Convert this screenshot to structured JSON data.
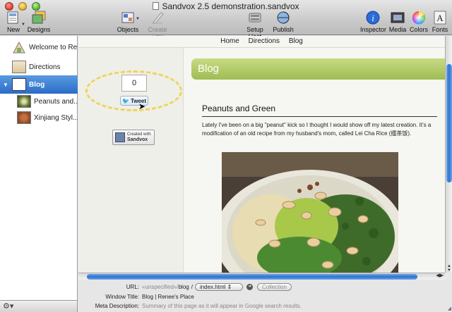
{
  "window": {
    "title": "Sandvox 2.5 demonstration.sandvox"
  },
  "toolbar": {
    "new_label": "New",
    "designs_label": "Designs",
    "objects_label": "Objects",
    "create_link_label": "Create Link",
    "setup_host_label": "Setup Host",
    "publish_label": "Publish",
    "inspector_label": "Inspector",
    "media_label": "Media",
    "colors_label": "Colors",
    "fonts_label": "Fonts"
  },
  "sidebar": {
    "items": [
      {
        "label": "Welcome to Re..."
      },
      {
        "label": "Directions"
      },
      {
        "label": "Blog",
        "expanded": true,
        "selected": true
      },
      {
        "label": "Peanuts and..."
      },
      {
        "label": "Xinjiang Styl..."
      }
    ]
  },
  "site": {
    "nav": [
      "Home",
      "Directions",
      "Blog"
    ],
    "tweet_count": "0",
    "tweet_label": "Tweet",
    "badge_line1": "Created with",
    "badge_line2": "Sandvox",
    "section_title": "Blog",
    "post_title": "Peanuts and Green",
    "post_body": "Lately I've been on a big \"peanut\" kick so I thought I would show off my latest creation. It's a modification of an old recipe from my husband's mom, called Lei Cha Rice (擂茶饭)."
  },
  "inspector": {
    "url_label": "URL:",
    "url_prefix": "«unspecified»/",
    "url_path": "blog",
    "url_sep": "/",
    "url_file": "index.html",
    "collection_label": "Collection",
    "window_title_label": "Window Title:",
    "window_title_value": "Blog | Renee's Place",
    "meta_label": "Meta Description:",
    "meta_placeholder": "Summary of this page as it will appear in Google search results."
  },
  "colors": {
    "accent": "#2a6cc8",
    "blog_bar": "#b4cd6b",
    "highlight": "#f0d45a"
  }
}
